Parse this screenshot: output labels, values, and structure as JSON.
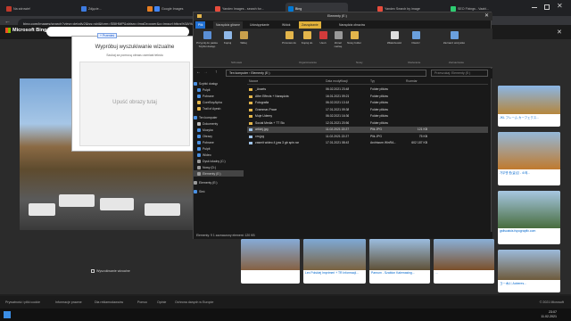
{
  "browser": {
    "tabs": [
      {
        "label": "Na zdrowie!"
      },
      {
        "label": "Zdjęcie..."
      },
      {
        "label": "..."
      },
      {
        "label": "Google Images"
      },
      {
        "label": "Yandex Images - search for..."
      },
      {
        "label": "Bing"
      },
      {
        "label": "Yandex Search by image"
      },
      {
        "label": "SEO Fixings - Vaahl..."
      }
    ],
    "url": "bing.com/images/search?view=detailv2&iss=sbi&form=SBIHMP&sbisrc=ImgDropper&q=imgurl:https%3A%2F%2F...",
    "tab_colors": [
      "#c0392b",
      "#3d7be0",
      "#e67e22",
      "#4285f4",
      "#e74c3c",
      "#0078d4",
      "#e74c3c",
      "#2ecc71"
    ]
  },
  "bing": {
    "logo": "Microsoft Bing",
    "visual_search": {
      "title": "Wypróbuj wyszukiwanie wizualne",
      "subtitle": "Szukaj za pomocą obrazu zamiast tekstu",
      "drop_label": "Upuść obrazy tutaj",
      "badge": "+ Przenieś"
    },
    "visual_search_footer": "Wyszukiwanie wizualne",
    "results": [
      {
        "caption": "Lex Polskiej Imprimeri + TR Informacji..."
      },
      {
        "caption": "Parnum - Szablon Kalemasing..."
      },
      {
        "caption": "..."
      }
    ],
    "right_captions": [
      "JKL フレーム カーフェクス...",
      "가우엔 한(글)임 - 소제...",
      "gsfiscalsis.fspograpfix.com",
      "ヨー木川 Aoberes..."
    ]
  },
  "explorer": {
    "window_title": "Elementy (E:)",
    "ribbon_tabs": [
      "Plik",
      "Narzędzia główne",
      "Udostępnianie",
      "Widok",
      "Zarządzanie",
      "Narzędzia obrazów"
    ],
    "ribbon_buttons": [
      {
        "label": "Przypnij do paska Szybki dostęp"
      },
      {
        "label": "Kopiuj"
      },
      {
        "label": "Wklej"
      },
      {
        "label": "Przenieś do"
      },
      {
        "label": "Kopiuj do"
      },
      {
        "label": "Usuń"
      },
      {
        "label": "Zmień nazwę"
      },
      {
        "label": "Nowy folder"
      },
      {
        "label": "Właściwości"
      },
      {
        "label": "Otwórz"
      },
      {
        "label": "Zaznacz wszystko"
      }
    ],
    "ribbon_groups": [
      "Schowek",
      "Organizowanie",
      "Nowy",
      "Otwieranie",
      "Zaznaczanie"
    ],
    "path": "Ten komputer › Elementy (E:)",
    "search_placeholder": "Przeszukaj: Elementy (E:)",
    "tree": [
      {
        "label": "Szybki dostęp"
      },
      {
        "label": "Pulpit"
      },
      {
        "label": "Pobrane"
      },
      {
        "label": "CoreBoyAlpha"
      },
      {
        "label": "Trail of Ayesh"
      },
      {
        "label": "Ten komputer"
      },
      {
        "label": "Dokumenty"
      },
      {
        "label": "Muzyka"
      },
      {
        "label": "Obrazy"
      },
      {
        "label": "Pobrane"
      },
      {
        "label": "Pulpit"
      },
      {
        "label": "Wideo"
      },
      {
        "label": "Dysk lokalny (C:)"
      },
      {
        "label": "Nowy (D:)"
      },
      {
        "label": "Elementy (E:)"
      },
      {
        "label": "Elementy (E:)"
      },
      {
        "label": "Sieć"
      }
    ],
    "columns": [
      "Nazwa",
      "Data modyfikacji",
      "Typ",
      "Rozmiar"
    ],
    "files": [
      {
        "name": "_Assets",
        "date": "06.02.2021 23:48",
        "type": "Folder plików",
        "size": ""
      },
      {
        "name": "After Effects + Narzędzia",
        "date": "16.01.2021 09:21",
        "type": "Folder plików",
        "size": ""
      },
      {
        "name": "Fotografia",
        "date": "06.02.2021 13:18",
        "type": "Folder plików",
        "size": ""
      },
      {
        "name": "Grammar-Prace",
        "date": "17.01.2021 09:38",
        "type": "Folder plików",
        "size": ""
      },
      {
        "name": "Muje Udemy",
        "date": "06.02.2021 16:36",
        "type": "Folder plików",
        "size": ""
      },
      {
        "name": "Social Media + TT Sto",
        "date": "12.01.2021 20:56",
        "type": "Folder plików",
        "size": ""
      },
      {
        "name": "artichj.jpg",
        "date": "11.02.2021 22:27",
        "type": "Plik JPG",
        "size": "121 KB"
      },
      {
        "name": "xm.jpg",
        "date": "11.02.2021 22:27",
        "type": "Plik JPG",
        "size": "75 KB"
      },
      {
        "name": "zasmit wideo 4 jyss 3 gb spin.rar",
        "date": "17.01.2021 08:43",
        "type": "Archiwum WinRA...",
        "size": "602 187 KB"
      }
    ],
    "selected_index": 6,
    "status": "Elementy: 9   1 zaznaczony element: 120 KB"
  },
  "footer": {
    "links": [
      "Prywatność i pliki cookie",
      "Informacje prawne",
      "Dla reklamodawców",
      "Pomoc",
      "Opinie",
      "Ochrona danych w Europie"
    ],
    "copyright": "© 2021 Microsoft"
  },
  "taskbar": {
    "time": "23:07",
    "date": "11.02.2021"
  }
}
